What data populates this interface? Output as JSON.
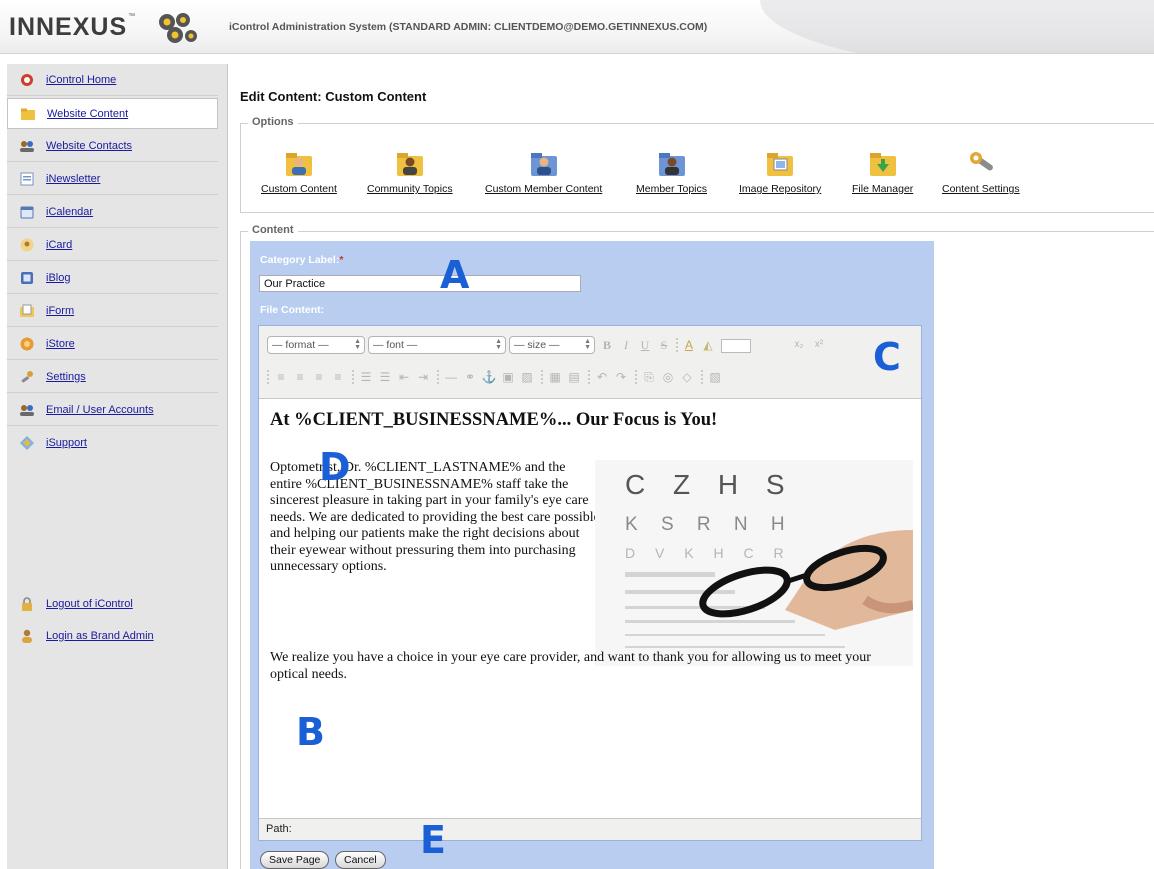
{
  "header": {
    "logo_text": "INNEXUS",
    "logo_tm": "™",
    "app_title": "iControl Administration System (STANDARD ADMIN: CLIENTDEMO@DEMO.GETINNEXUS.COM)"
  },
  "sidebar": {
    "items": [
      {
        "label": "iControl Home",
        "icon": "home-icon"
      },
      {
        "label": "Website Content",
        "icon": "folder-icon"
      },
      {
        "label": "Website Contacts",
        "icon": "contacts-icon"
      },
      {
        "label": "iNewsletter",
        "icon": "newsletter-icon"
      },
      {
        "label": "iCalendar",
        "icon": "calendar-icon"
      },
      {
        "label": "iCard",
        "icon": "card-icon"
      },
      {
        "label": "iBlog",
        "icon": "blog-icon"
      },
      {
        "label": "iForm",
        "icon": "form-icon"
      },
      {
        "label": "iStore",
        "icon": "store-icon"
      },
      {
        "label": "Settings",
        "icon": "settings-icon"
      },
      {
        "label": "Email / User Accounts",
        "icon": "users-icon"
      },
      {
        "label": "iSupport",
        "icon": "support-icon"
      }
    ],
    "bottom_items": [
      {
        "label": "Logout of iControl",
        "icon": "lock-icon"
      },
      {
        "label": "Login as Brand Admin",
        "icon": "user-icon"
      }
    ],
    "active_item": "Website Content"
  },
  "main": {
    "title": "Edit Content: Custom Content",
    "options_legend": "Options",
    "content_legend": "Content",
    "options": [
      {
        "label": "Custom Content",
        "icon": "user-folder-icon"
      },
      {
        "label": "Community Topics",
        "icon": "user-folder-icon"
      },
      {
        "label": "Custom Member Content",
        "icon": "member-folder-icon"
      },
      {
        "label": "Member Topics",
        "icon": "member-folder-icon"
      },
      {
        "label": "Image Repository",
        "icon": "image-folder-icon"
      },
      {
        "label": "File Manager",
        "icon": "file-folder-icon"
      },
      {
        "label": "Content Settings",
        "icon": "wrench-icon"
      }
    ]
  },
  "form": {
    "category_label": "Category Label:",
    "required_mark": "*",
    "category_value": "Our Practice",
    "file_content_label": "File Content:",
    "toolbar": {
      "format": "— format —",
      "font": "— font —",
      "size": "— size —"
    },
    "heading": "At %CLIENT_BUSINESSNAME%... Our Focus is You!",
    "paragraph1": "Optometrist, Dr. %CLIENT_LASTNAME% and the entire %CLIENT_BUSINESSNAME% staff take the sincerest pleasure in taking part in your family's eye care needs.  We are dedicated to providing the best care possible and helping our patients make the right decisions about their eyewear without pressuring them into purchasing unnecessary options.",
    "paragraph2": "We realize you have a choice in your eye care provider, and want to thank you for allowing us to meet your optical needs.",
    "eye_chart": {
      "row1": "C Z H S",
      "row2": "K S R N H",
      "row3": "D V K H C R"
    },
    "path_label": "Path:",
    "save_label": "Save Page",
    "cancel_label": "Cancel"
  },
  "callouts": {
    "a": "A",
    "b": "B",
    "c": "C",
    "d": "D",
    "e": "E"
  },
  "colors": {
    "panel": "#b8cdf0",
    "link": "#1a1aa0",
    "callout": "#1a5fd6"
  }
}
